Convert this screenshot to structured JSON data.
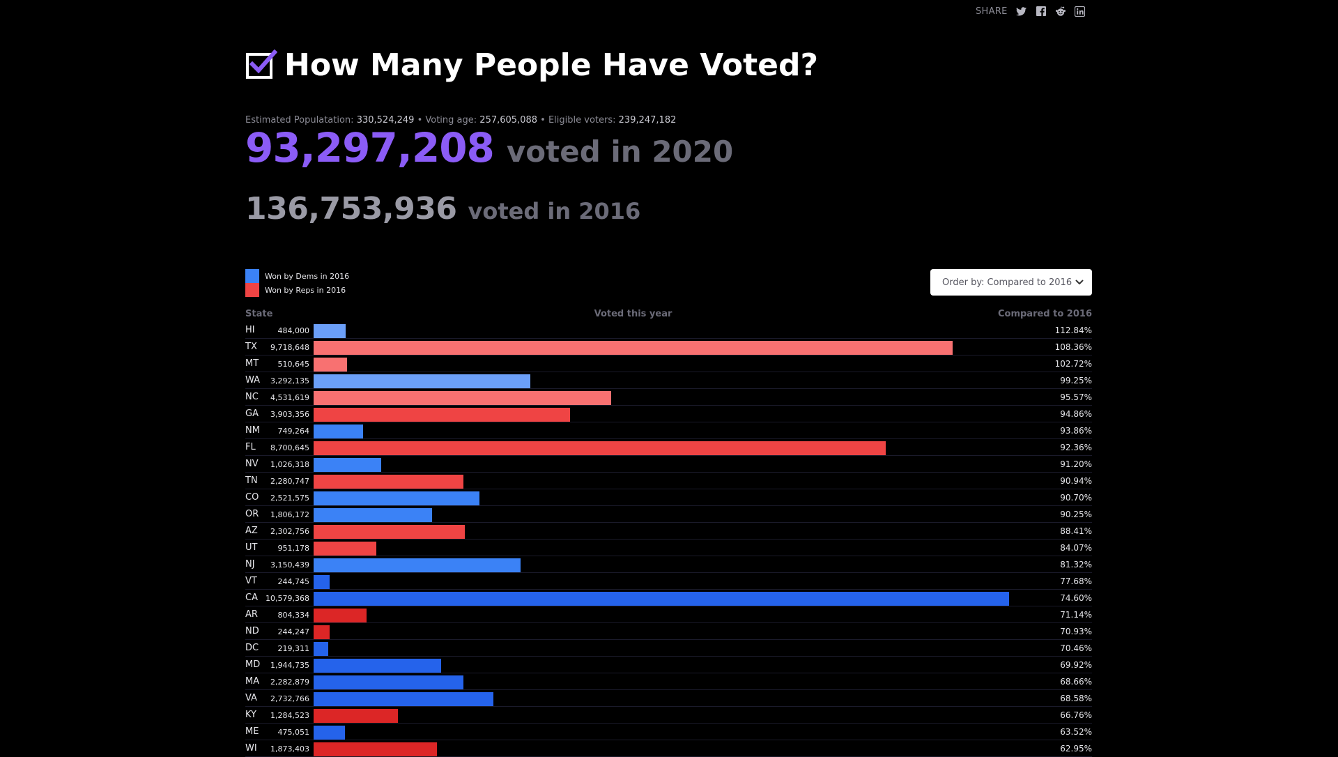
{
  "share": {
    "label": "SHARE",
    "icons": [
      "twitter-icon",
      "facebook-icon",
      "reddit-icon",
      "linkedin-icon"
    ]
  },
  "header": {
    "title": "How Many People Have Voted?"
  },
  "stats": {
    "population_label": "Estimated Populatation:",
    "population": "330,524,249",
    "voting_age_label": "Voting age:",
    "voting_age": "257,605,088",
    "eligible_label": "Eligible voters:",
    "eligible": "239,247,182",
    "separator": "•"
  },
  "totals": {
    "voted_2020": "93,297,208",
    "voted_2020_label": "voted in 2020",
    "voted_2016": "136,753,936",
    "voted_2016_label": "voted in 2016"
  },
  "legend": {
    "dems": "Won by Dems in 2016",
    "reps": "Won by Reps in 2016"
  },
  "order_by": {
    "label": "Order by:",
    "value": "Compared to 2016"
  },
  "table": {
    "col_state": "State",
    "col_voted": "Voted this year",
    "col_compared": "Compared to 2016"
  },
  "colors": {
    "accent": "#8b5cf6",
    "dem_light": "#6b9ff8",
    "dem_mid": "#3b82f6",
    "dem_strong": "#2563eb",
    "rep_light": "#f87171",
    "rep_mid": "#ef4444",
    "rep_strong": "#dc2626",
    "legend_dem": "#3b82f6",
    "legend_rep": "#ef4444"
  },
  "chart_data": {
    "type": "bar",
    "x_max": 10579368,
    "categories": [
      "HI",
      "TX",
      "MT",
      "WA",
      "NC",
      "GA",
      "NM",
      "FL",
      "NV",
      "TN",
      "CO",
      "OR",
      "AZ",
      "UT",
      "NJ",
      "VT",
      "CA",
      "AR",
      "ND",
      "DC",
      "MD",
      "MA",
      "VA",
      "KY",
      "ME",
      "WI"
    ],
    "values": [
      484000,
      9718648,
      510645,
      3292135,
      4531619,
      3903356,
      749264,
      8700645,
      1026318,
      2280747,
      2521575,
      1806172,
      2302756,
      951178,
      3150439,
      244745,
      10579368,
      804334,
      244247,
      219311,
      1944735,
      2282879,
      2732766,
      1284523,
      475051,
      1873403
    ],
    "value_labels": [
      "484,000",
      "9,718,648",
      "510,645",
      "3,292,135",
      "4,531,619",
      "3,903,356",
      "749,264",
      "8,700,645",
      "1,026,318",
      "2,280,747",
      "2,521,575",
      "1,806,172",
      "2,302,756",
      "951,178",
      "3,150,439",
      "244,745",
      "10,579,368",
      "804,334",
      "244,247",
      "219,311",
      "1,944,735",
      "2,282,879",
      "2,732,766",
      "1,284,523",
      "475,051",
      "1,873,403"
    ],
    "compared": [
      "112.84%",
      "108.36%",
      "102.72%",
      "99.25%",
      "95.57%",
      "94.86%",
      "93.86%",
      "92.36%",
      "91.20%",
      "90.94%",
      "90.70%",
      "90.25%",
      "88.41%",
      "84.07%",
      "81.32%",
      "77.68%",
      "74.60%",
      "71.14%",
      "70.93%",
      "70.46%",
      "69.92%",
      "68.66%",
      "68.58%",
      "66.76%",
      "63.52%",
      "62.95%"
    ],
    "party": [
      "D",
      "R",
      "R",
      "D",
      "R",
      "R",
      "D",
      "R",
      "D",
      "R",
      "D",
      "D",
      "R",
      "R",
      "D",
      "D",
      "D",
      "R",
      "R",
      "D",
      "D",
      "D",
      "D",
      "R",
      "D",
      "R"
    ]
  }
}
